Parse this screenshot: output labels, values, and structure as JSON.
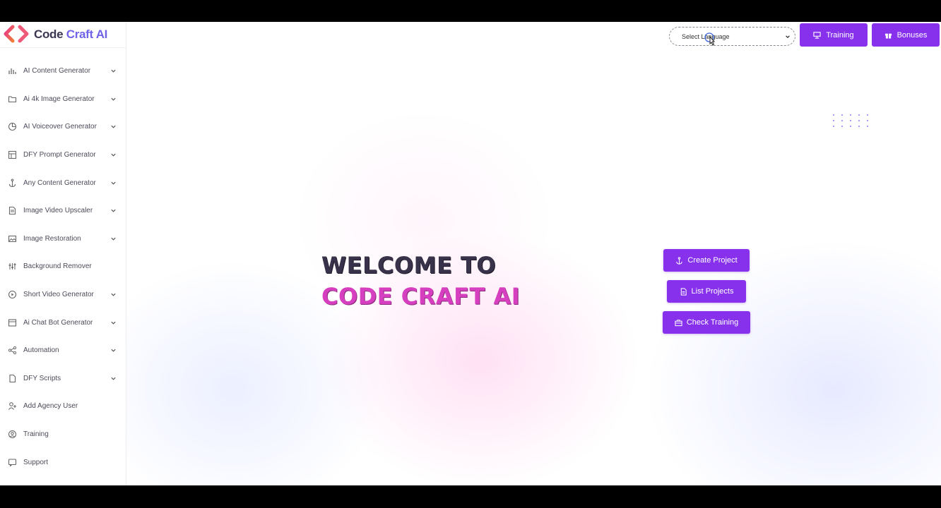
{
  "brand": {
    "name_main": "Code ",
    "name_accent": "Craft AI"
  },
  "sidebar": {
    "items": [
      {
        "label": "AI Content Generator",
        "icon": "bar-chart-icon",
        "expandable": true
      },
      {
        "label": "Ai 4k Image Generator",
        "icon": "folder-icon",
        "expandable": true
      },
      {
        "label": "AI Voiceover Generator",
        "icon": "pie-chart-icon",
        "expandable": true
      },
      {
        "label": "DFY Prompt Generator",
        "icon": "grid-icon",
        "expandable": true
      },
      {
        "label": "Any Content Generator",
        "icon": "anchor-icon",
        "expandable": true
      },
      {
        "label": "Image Video Upscaler",
        "icon": "document-icon",
        "expandable": true
      },
      {
        "label": "Image Restoration",
        "icon": "image-icon",
        "expandable": true
      },
      {
        "label": "Background Remover",
        "icon": "sliders-icon",
        "expandable": false
      },
      {
        "label": "Short Video Generator",
        "icon": "video-icon",
        "expandable": true
      },
      {
        "label": "Ai Chat Bot Generator",
        "icon": "list-icon",
        "expandable": true
      },
      {
        "label": "Automation",
        "icon": "share-icon",
        "expandable": true
      },
      {
        "label": "DFY Scripts",
        "icon": "file-icon",
        "expandable": true
      },
      {
        "label": "Add Agency User",
        "icon": "user-add-icon",
        "expandable": false
      },
      {
        "label": "Training",
        "icon": "user-circle-icon",
        "expandable": false
      },
      {
        "label": "Support",
        "icon": "chat-icon",
        "expandable": false
      }
    ]
  },
  "header": {
    "language_select": "Select Language",
    "training_label": "Training",
    "bonuses_label": "Bonuses"
  },
  "hero": {
    "line1": "WELCOME TO",
    "line2": "CODE CRAFT AI"
  },
  "actions": {
    "create_project": "Create Project",
    "list_projects": "List Projects",
    "check_training": "Check Training"
  },
  "colors": {
    "accent": "#8731ec",
    "brand_pink": "#d63fbf",
    "brand_blue": "#6f63e8"
  }
}
